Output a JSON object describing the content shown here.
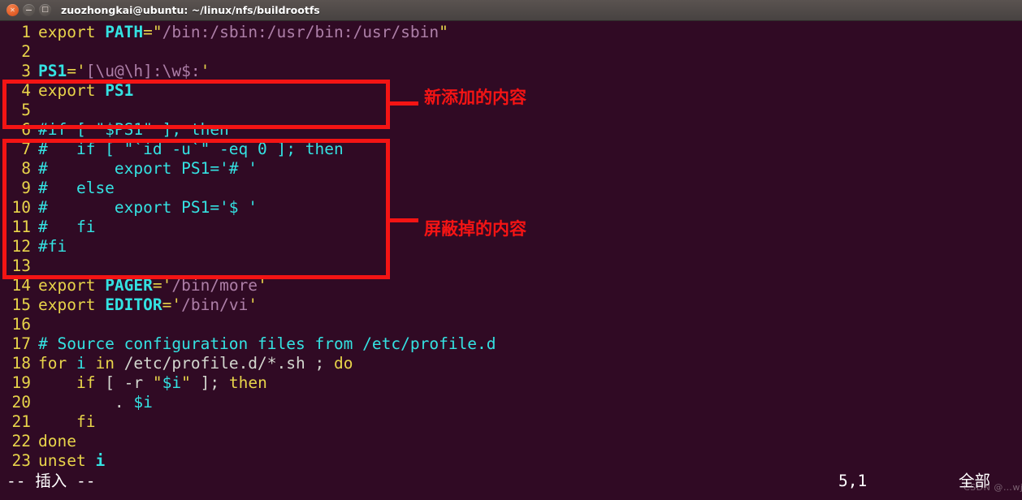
{
  "window": {
    "title": "zuozhongkai@ubuntu: ~/linux/nfs/buildrootfs",
    "controls": {
      "close_glyph": "✕",
      "minimize_glyph": "−",
      "maximize_glyph": "□",
      "close_name": "close",
      "minimize_name": "minimize",
      "maximize_name": "maximize"
    }
  },
  "editor": {
    "lines": [
      {
        "n": "1",
        "tokens": [
          {
            "t": "export ",
            "c": "kw"
          },
          {
            "t": "PATH",
            "c": "ident"
          },
          {
            "t": "=",
            "c": "op"
          },
          {
            "t": "\"",
            "c": "quote"
          },
          {
            "t": "/bin:/sbin:/usr/bin:/usr/sbin",
            "c": "str"
          },
          {
            "t": "\"",
            "c": "quote"
          }
        ]
      },
      {
        "n": "2",
        "tokens": []
      },
      {
        "n": "3",
        "tokens": [
          {
            "t": "PS1",
            "c": "ident"
          },
          {
            "t": "=",
            "c": "op"
          },
          {
            "t": "'",
            "c": "quote"
          },
          {
            "t": "[\\u@\\h]:\\w$:",
            "c": "str"
          },
          {
            "t": "'",
            "c": "quote"
          }
        ]
      },
      {
        "n": "4",
        "tokens": [
          {
            "t": "export ",
            "c": "kw"
          },
          {
            "t": "PS1",
            "c": "ident"
          }
        ]
      },
      {
        "n": "5",
        "tokens": []
      },
      {
        "n": "6",
        "tokens": [
          {
            "t": "#if [ \"$PS1\" ]; then",
            "c": "cmt"
          }
        ]
      },
      {
        "n": "7",
        "tokens": [
          {
            "t": "#   if [ \"`id -u`\" -eq 0 ]; then",
            "c": "cmt"
          }
        ]
      },
      {
        "n": "8",
        "tokens": [
          {
            "t": "#       export PS1='# '",
            "c": "cmt"
          }
        ]
      },
      {
        "n": "9",
        "tokens": [
          {
            "t": "#   else",
            "c": "cmt"
          }
        ]
      },
      {
        "n": "10",
        "tokens": [
          {
            "t": "#       export PS1='$ '",
            "c": "cmt"
          }
        ]
      },
      {
        "n": "11",
        "tokens": [
          {
            "t": "#   fi",
            "c": "cmt"
          }
        ]
      },
      {
        "n": "12",
        "tokens": [
          {
            "t": "#fi",
            "c": "cmt"
          }
        ]
      },
      {
        "n": "13",
        "tokens": []
      },
      {
        "n": "14",
        "tokens": [
          {
            "t": "export ",
            "c": "kw"
          },
          {
            "t": "PAGER",
            "c": "ident"
          },
          {
            "t": "=",
            "c": "op"
          },
          {
            "t": "'",
            "c": "quote"
          },
          {
            "t": "/bin/more",
            "c": "str"
          },
          {
            "t": "'",
            "c": "quote"
          }
        ]
      },
      {
        "n": "15",
        "tokens": [
          {
            "t": "export ",
            "c": "kw"
          },
          {
            "t": "EDITOR",
            "c": "ident"
          },
          {
            "t": "=",
            "c": "op"
          },
          {
            "t": "'",
            "c": "quote"
          },
          {
            "t": "/bin/vi",
            "c": "str"
          },
          {
            "t": "'",
            "c": "quote"
          }
        ]
      },
      {
        "n": "16",
        "tokens": []
      },
      {
        "n": "17",
        "tokens": [
          {
            "t": "# Source configuration files from /etc/profile.d",
            "c": "cmt"
          }
        ]
      },
      {
        "n": "18",
        "tokens": [
          {
            "t": "for ",
            "c": "kw"
          },
          {
            "t": "i",
            "c": "var"
          },
          {
            "t": " in ",
            "c": "kw"
          },
          {
            "t": "/etc/profile.d/*.sh ; ",
            "c": "plain"
          },
          {
            "t": "do",
            "c": "kw"
          }
        ]
      },
      {
        "n": "19",
        "tokens": [
          {
            "t": "    if ",
            "c": "kw"
          },
          {
            "t": "[ -r ",
            "c": "plain"
          },
          {
            "t": "\"",
            "c": "quote"
          },
          {
            "t": "$i",
            "c": "var"
          },
          {
            "t": "\"",
            "c": "quote"
          },
          {
            "t": " ]; ",
            "c": "plain"
          },
          {
            "t": "then",
            "c": "kw"
          }
        ]
      },
      {
        "n": "20",
        "tokens": [
          {
            "t": "        . ",
            "c": "plain"
          },
          {
            "t": "$i",
            "c": "var"
          }
        ]
      },
      {
        "n": "21",
        "tokens": [
          {
            "t": "    fi",
            "c": "kw"
          }
        ]
      },
      {
        "n": "22",
        "tokens": [
          {
            "t": "done",
            "c": "kw"
          }
        ]
      },
      {
        "n": "23",
        "tokens": [
          {
            "t": "unset ",
            "c": "kw"
          },
          {
            "t": "i",
            "c": "ident"
          }
        ]
      }
    ]
  },
  "annotations": {
    "added": {
      "label": "新添加的内容"
    },
    "commented": {
      "label": "屏蔽掉的内容"
    },
    "box_color": "#f41414"
  },
  "status_bar": {
    "mode": "-- 插入 --",
    "position": "5,1",
    "scroll": "全部",
    "watermark": "CSDN @…wj"
  },
  "colors": {
    "terminal_bg": "#300a24",
    "titlebar_bg": "#4c4745",
    "keyword": "#e8d44a",
    "identifier": "#34e2e2",
    "string": "#ad7fa8",
    "comment": "#34e2e2",
    "annotation_red": "#f41414"
  }
}
